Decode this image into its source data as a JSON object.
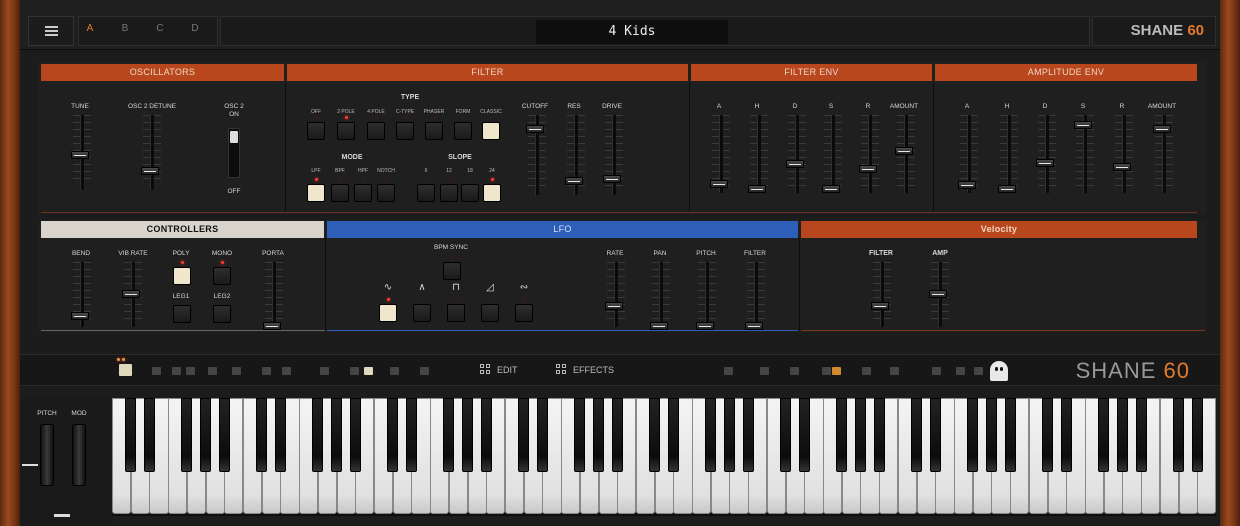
{
  "topbar": {
    "tabs": [
      "A",
      "B",
      "C",
      "D"
    ],
    "active_tab": "A",
    "preset_name": "4 Kids",
    "brand_text": "SHANE",
    "brand_number": "60"
  },
  "oscillators": {
    "title": "OSCILLATORS",
    "tune_label": "TUNE",
    "osc2_detune_label": "OSC 2 DETUNE",
    "osc2_on_label": "OSC 2\nON",
    "off_label": "OFF"
  },
  "filter": {
    "title": "FILTER",
    "type_label": "TYPE",
    "types": [
      "OFF",
      "2 POLE",
      "4 POLE",
      "C-TYPE",
      "PHASER",
      "FORM",
      "CLASSIC"
    ],
    "mode_label": "MODE",
    "modes": [
      "LPF",
      "BPF",
      "HPF",
      "NOTCH"
    ],
    "slope_label": "SLOPE",
    "slopes": [
      "6",
      "12",
      "18",
      "24"
    ],
    "cutoff_label": "CUTOFF",
    "res_label": "RES",
    "drive_label": "DRIVE"
  },
  "filter_env": {
    "title": "FILTER ENV",
    "labels": [
      "A",
      "H",
      "D",
      "S",
      "R",
      "AMOUNT"
    ]
  },
  "amp_env": {
    "title": "AMPLITUDE ENV",
    "labels": [
      "A",
      "H",
      "D",
      "S",
      "R",
      "AMOUNT"
    ]
  },
  "controllers": {
    "title": "CONTROLLERS",
    "bend_label": "BEND",
    "vib_rate_label": "VIB RATE",
    "poly_label": "POLY",
    "mono_label": "MONO",
    "leg1_label": "LEG1",
    "leg2_label": "LEG2",
    "porta_label": "PORTA"
  },
  "lfo": {
    "title": "LFO",
    "bpm_sync_label": "BPM SYNC",
    "rate_label": "RATE",
    "pan_label": "PAN",
    "pitch_label": "PITCH",
    "filter_label": "FILTER"
  },
  "velocity": {
    "title": "Velocity",
    "filter_label": "FILTER",
    "amp_label": "AMP"
  },
  "toolbar": {
    "edit_label": "EDIT",
    "effects_label": "EFFECTS",
    "brand_text": "SHANE",
    "brand_number": "60"
  },
  "wheels": {
    "pitch_label": "PITCH",
    "mod_label": "MOD"
  },
  "colors": {
    "accent": "#e07a2c",
    "section_orange": "#b8471e",
    "section_blue": "#2e5fb8",
    "section_grey": "#d8d4cc",
    "led_red": "#ff3b2b"
  }
}
